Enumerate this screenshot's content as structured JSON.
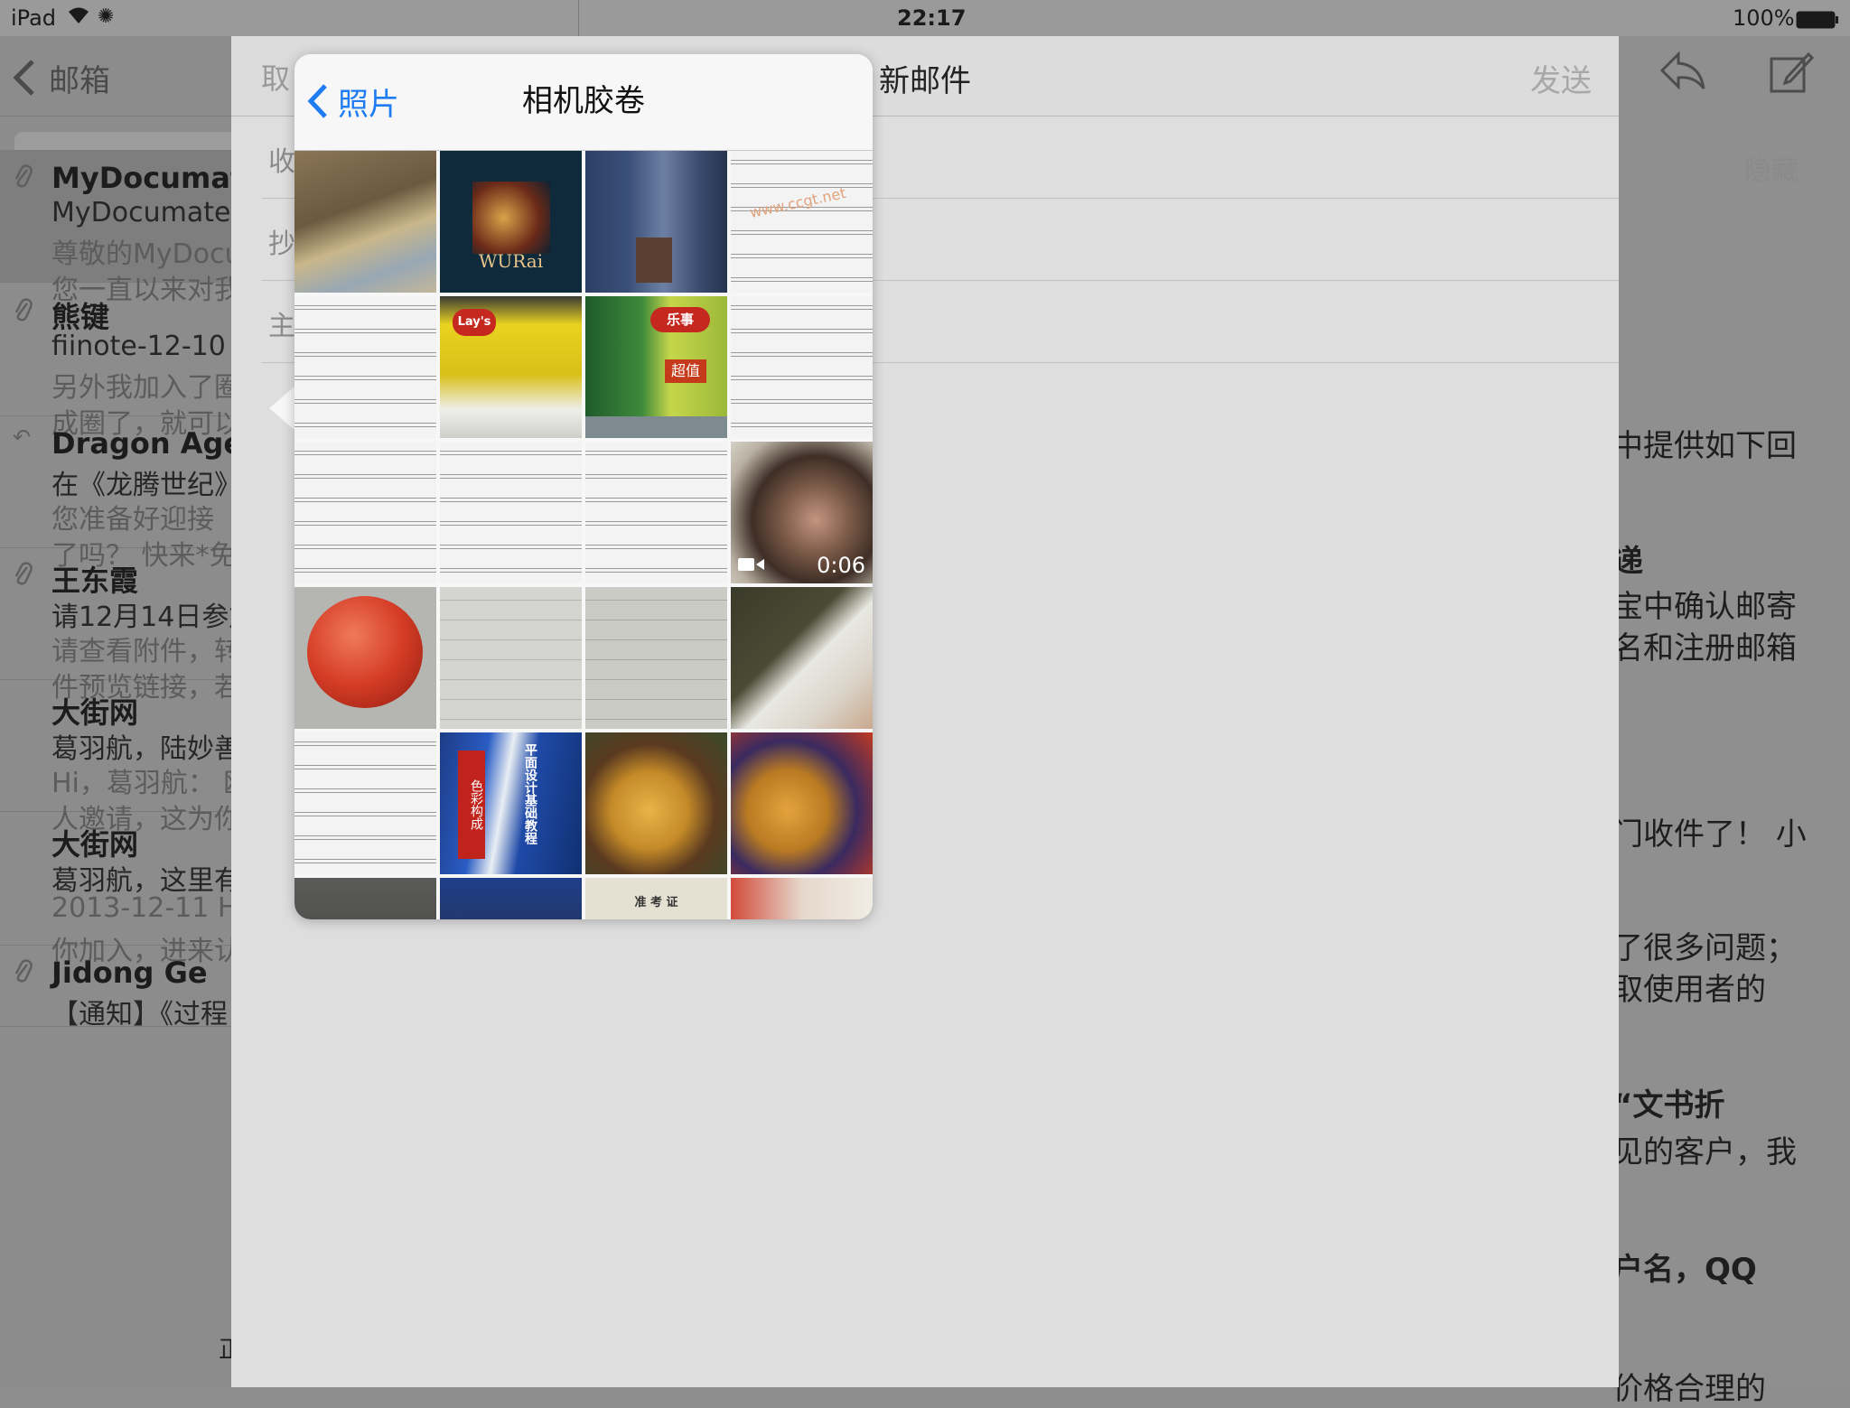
{
  "status": {
    "device": "iPad",
    "time": "22:17",
    "battery": "100%"
  },
  "mail_list": {
    "back_label": "邮箱",
    "items": [
      {
        "sender": "MyDocumate",
        "subject": "MyDocumate",
        "preview": [
          "尊敬的MyDocu",
          "您一直以来对我"
        ],
        "icon": "paperclip-icon",
        "selected": true
      },
      {
        "sender": "熊键",
        "subject": "fiinote-12-10",
        "preview": [
          "另外我加入了圈",
          "成圈了，就可以"
        ],
        "icon": "paperclip-icon",
        "selected": false
      },
      {
        "sender": "Dragon Age",
        "subject": "在《龙腾世纪》",
        "preview": [
          "您准备好迎接",
          "了吗？ 快来*免"
        ],
        "icon": "",
        "selected": false
      },
      {
        "sender": "王东霞",
        "subject": "请12月14日参加",
        "preview": [
          "请查看附件，转",
          "件预览链接，若"
        ],
        "icon": "paperclip-icon",
        "selected": false
      },
      {
        "sender": "大街网",
        "subject": "葛羽航，陆妙善",
        "preview": [
          "Hi，葛羽航：  欧",
          "人邀请，这为你"
        ],
        "icon": "",
        "selected": false
      },
      {
        "sender": "大街网",
        "subject": "葛羽航，这里有",
        "preview": [
          "2013-12-11 Hi",
          "你加入，进来认"
        ],
        "icon": "",
        "selected": false
      },
      {
        "sender": "Jidong Ge",
        "subject": "【通知】《过程",
        "preview": [],
        "icon": "paperclip-icon",
        "selected": false
      }
    ],
    "bottom_fragment": "正"
  },
  "message": {
    "lines": [
      "中提供如下回",
      "递",
      "宝中确认邮寄",
      "名和注册邮箱",
      "门收件了！ 小",
      "了很多问题；",
      "取使用者的",
      "“文书折",
      "见的客户，我",
      "户名，QQ",
      "价格合理的"
    ]
  },
  "compose": {
    "cancel_fragment": "取",
    "title": "新邮件",
    "send_label": "发送",
    "hide_label": "隐藏",
    "field_fragments": [
      "收",
      "抄",
      "主"
    ]
  },
  "photo_picker": {
    "back_label": "照片",
    "title": "相机胶卷",
    "video_duration": "0:06",
    "photo_text": {
      "album_cover": "WURai",
      "chips_left": "Lay's",
      "chips_right": "乐事",
      "chips_badge": "超值",
      "book_spine": "色彩构成",
      "book_cover": "平面设计基础教程",
      "ticket_title": "准 考 证",
      "watermark": "www.ccgt.net"
    }
  },
  "colors": {
    "ios_blue": "#1f7cf2",
    "dim_background": "#8e8e8e",
    "compose_background": "#dedede",
    "popover_background": "#f7f7f7",
    "disabled_gray": "#a8a8a8"
  }
}
